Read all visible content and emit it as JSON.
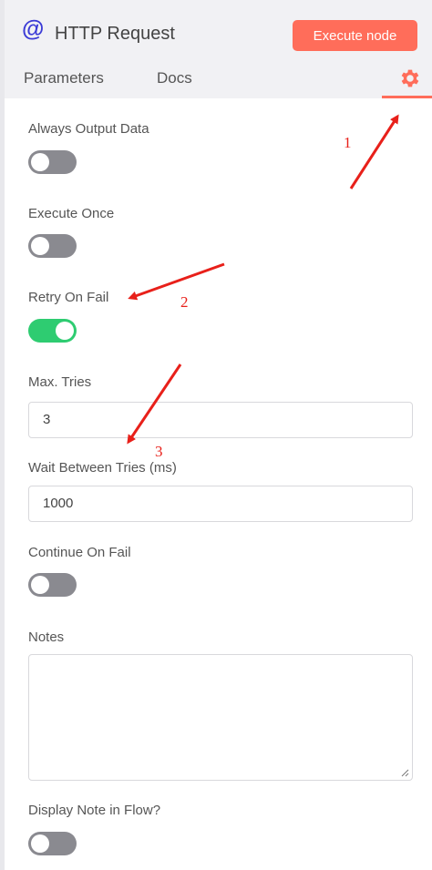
{
  "header": {
    "icon": "at-sign-icon",
    "title": "HTTP Request",
    "execute_label": "Execute node"
  },
  "tabs": [
    {
      "label": "Parameters"
    },
    {
      "label": "Docs"
    },
    {
      "label": "",
      "icon": "gear-icon",
      "active": true
    }
  ],
  "settings": {
    "always_output": {
      "label": "Always Output Data",
      "on": false
    },
    "execute_once": {
      "label": "Execute Once",
      "on": false
    },
    "retry_on_fail": {
      "label": "Retry On Fail",
      "on": true
    },
    "max_tries": {
      "label": "Max. Tries",
      "value": "3"
    },
    "wait_between": {
      "label": "Wait Between Tries (ms)",
      "value": "1000"
    },
    "continue_on_fail": {
      "label": "Continue On Fail",
      "on": false
    },
    "notes": {
      "label": "Notes",
      "value": ""
    },
    "display_note": {
      "label": "Display Note in Flow?",
      "on": false
    }
  },
  "annotations": {
    "a1": "1",
    "a2": "2",
    "a3": "3"
  },
  "colors": {
    "accent": "#ff6d5a",
    "toggle_on": "#2ecc71",
    "toggle_off": "#8a8a90",
    "annotation": "#e8201a",
    "icon": "#3b3bd6"
  }
}
